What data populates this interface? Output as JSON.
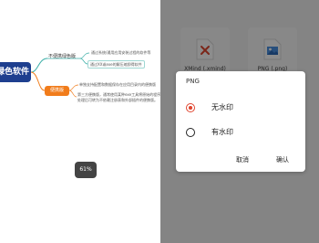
{
  "mindmap": {
    "root_label": "绿色软件",
    "branch_plain": "不便携绿色版",
    "branch_orange": "便携版",
    "leaf_1": "通过系统/通用应用安装过程的软件等",
    "leaf_2": "通过XX或exe的解压缩即得软件",
    "leaf_3": "单独支持配置和数据保存在应用目录内的便携版",
    "leaf_4_lines": [
      "第三方便携版，通常使用某种exe工具将原始的程序，",
      "处理后可转为不依赖注册表和外部插件的便携版。"
    ]
  },
  "zoom": "61%",
  "files": {
    "xmind_label": "XMind (.xmind)",
    "png_label": "PNG (.png)"
  },
  "dialog": {
    "title": "PNG",
    "option_1": "无水印",
    "option_2": "有水印",
    "selected_option": "无水印",
    "cancel": "取消",
    "confirm": "确认"
  },
  "colors": {
    "accent": "#e0452f",
    "root_node": "#1e3f8f",
    "orange_branch": "#f17c1b",
    "teal_connector": "#3aaea6"
  }
}
